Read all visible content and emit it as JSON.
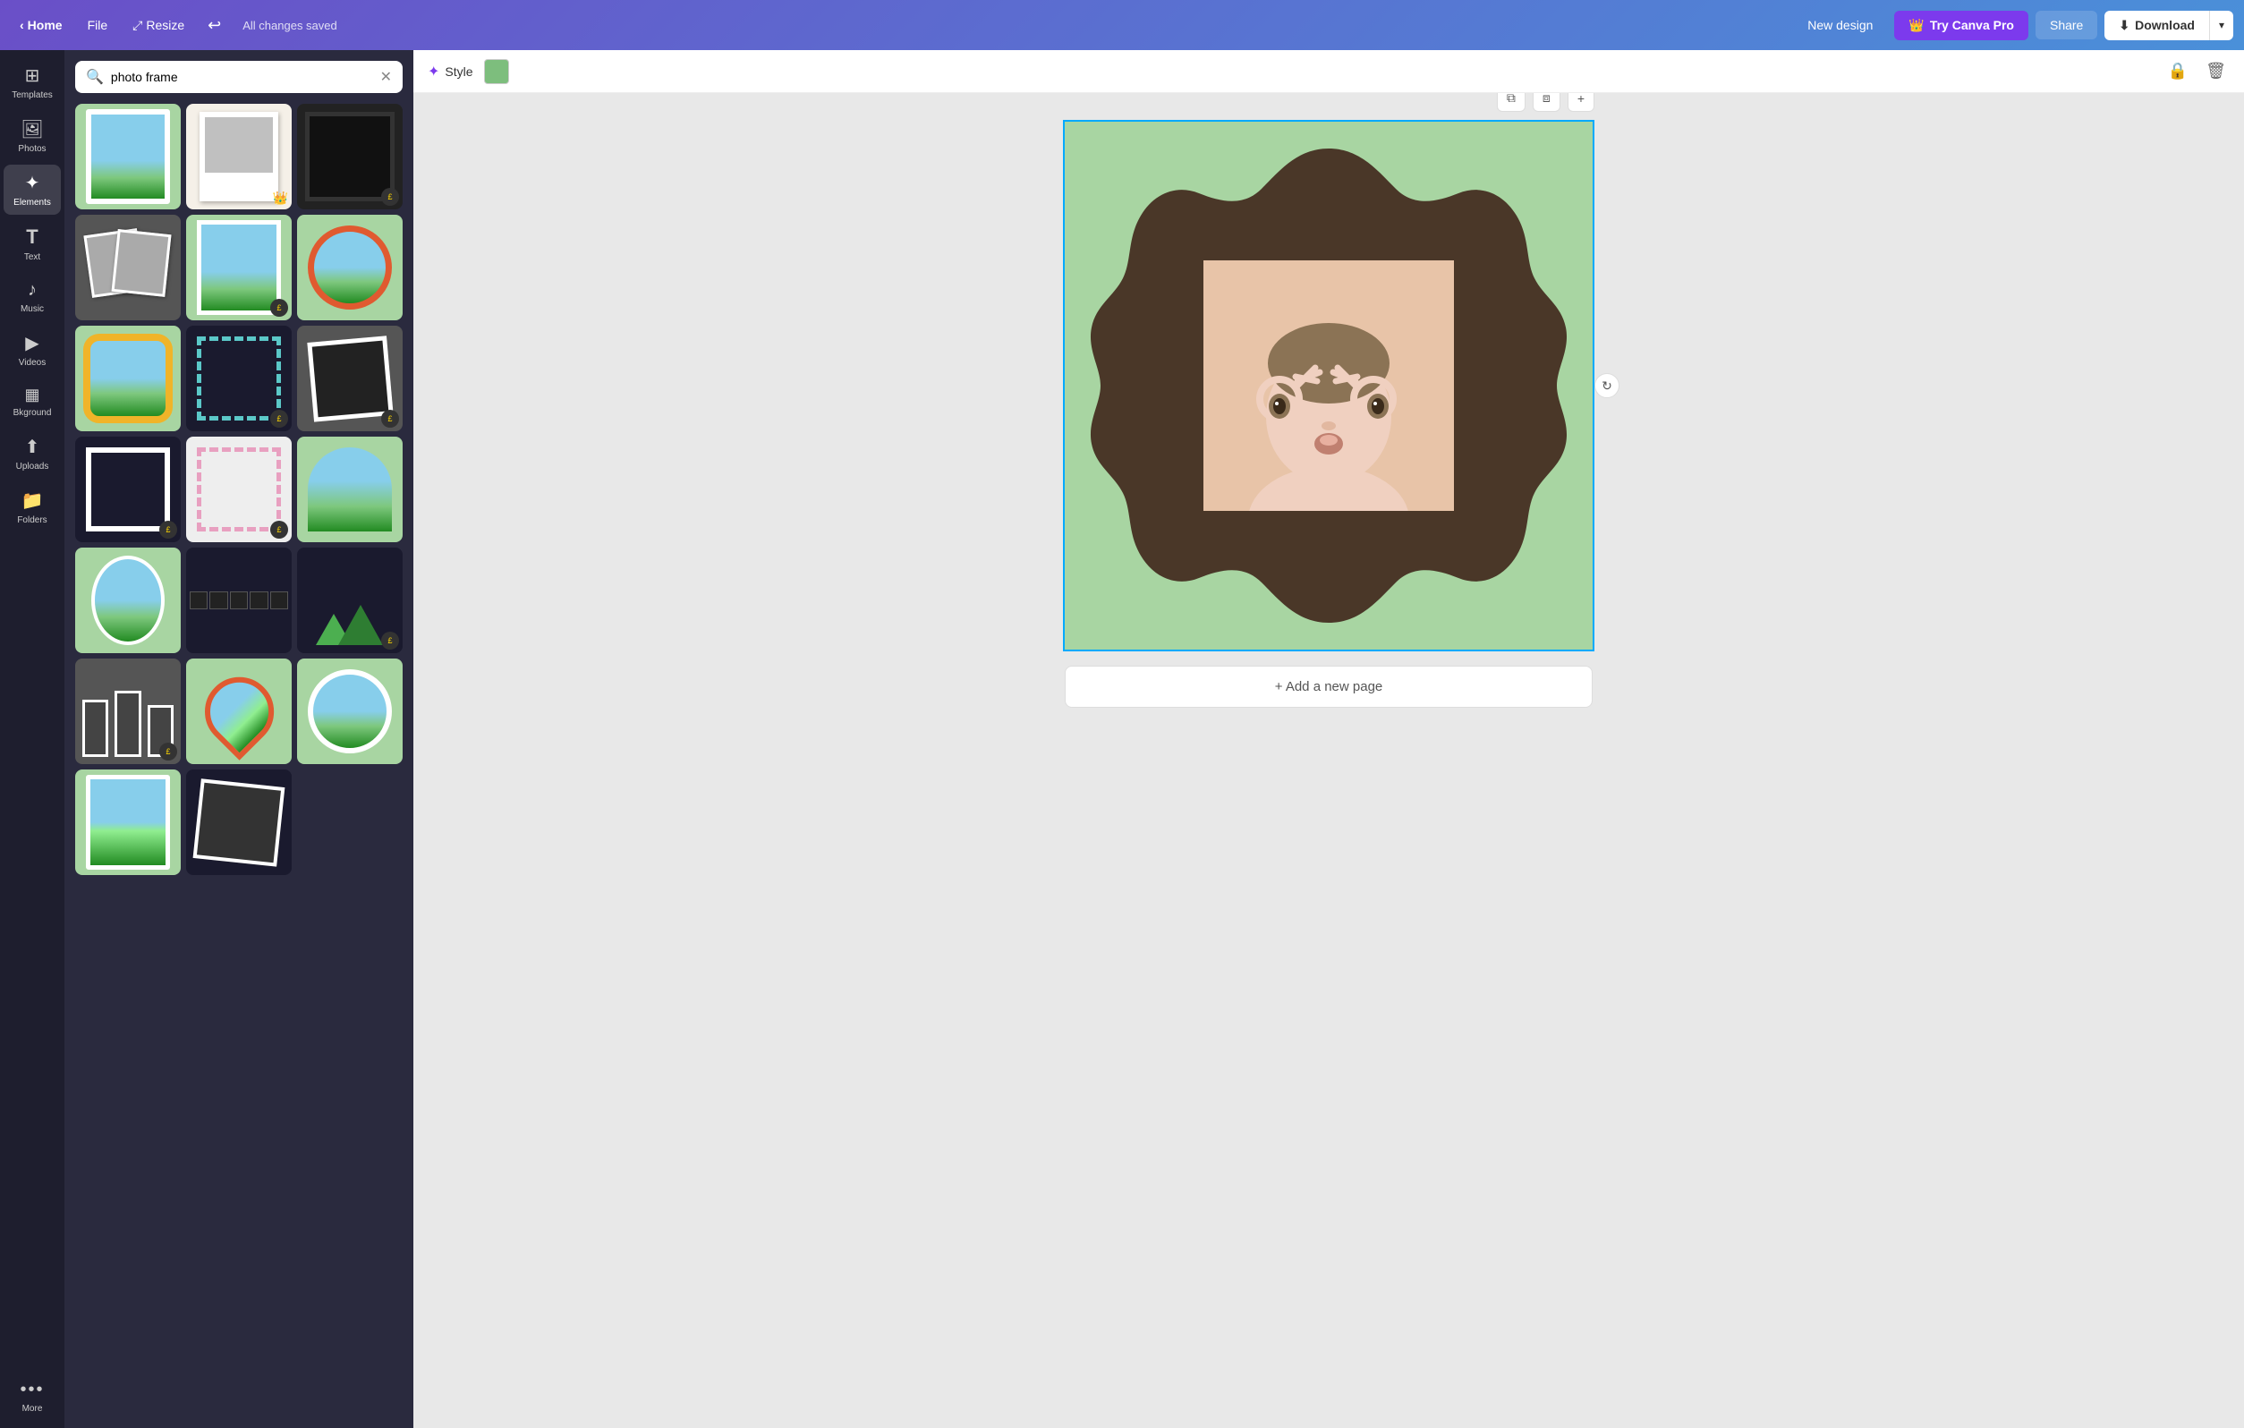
{
  "topnav": {
    "home_label": "Home",
    "file_label": "File",
    "resize_label": "Resize",
    "saved_status": "All changes saved",
    "new_design_label": "New design",
    "try_pro_label": "Try Canva Pro",
    "share_label": "Share",
    "download_label": "Download"
  },
  "sidebar": {
    "items": [
      {
        "id": "templates",
        "label": "Templates",
        "icon": "⊞"
      },
      {
        "id": "photos",
        "label": "Photos",
        "icon": "🖼"
      },
      {
        "id": "elements",
        "label": "Elements",
        "icon": "✦"
      },
      {
        "id": "text",
        "label": "Text",
        "icon": "T"
      },
      {
        "id": "music",
        "label": "Music",
        "icon": "♪"
      },
      {
        "id": "videos",
        "label": "Videos",
        "icon": "▶"
      },
      {
        "id": "background",
        "label": "Bkground",
        "icon": "▦"
      },
      {
        "id": "uploads",
        "label": "Uploads",
        "icon": "↑"
      },
      {
        "id": "folders",
        "label": "Folders",
        "icon": "📁"
      },
      {
        "id": "more",
        "label": "More",
        "icon": "•••"
      }
    ]
  },
  "panel": {
    "search_placeholder": "photo frame",
    "search_value": "photo frame"
  },
  "toolbar": {
    "style_label": "Style",
    "color_value": "#7dbe7d"
  },
  "canvas": {
    "add_page_label": "+ Add a new page"
  }
}
